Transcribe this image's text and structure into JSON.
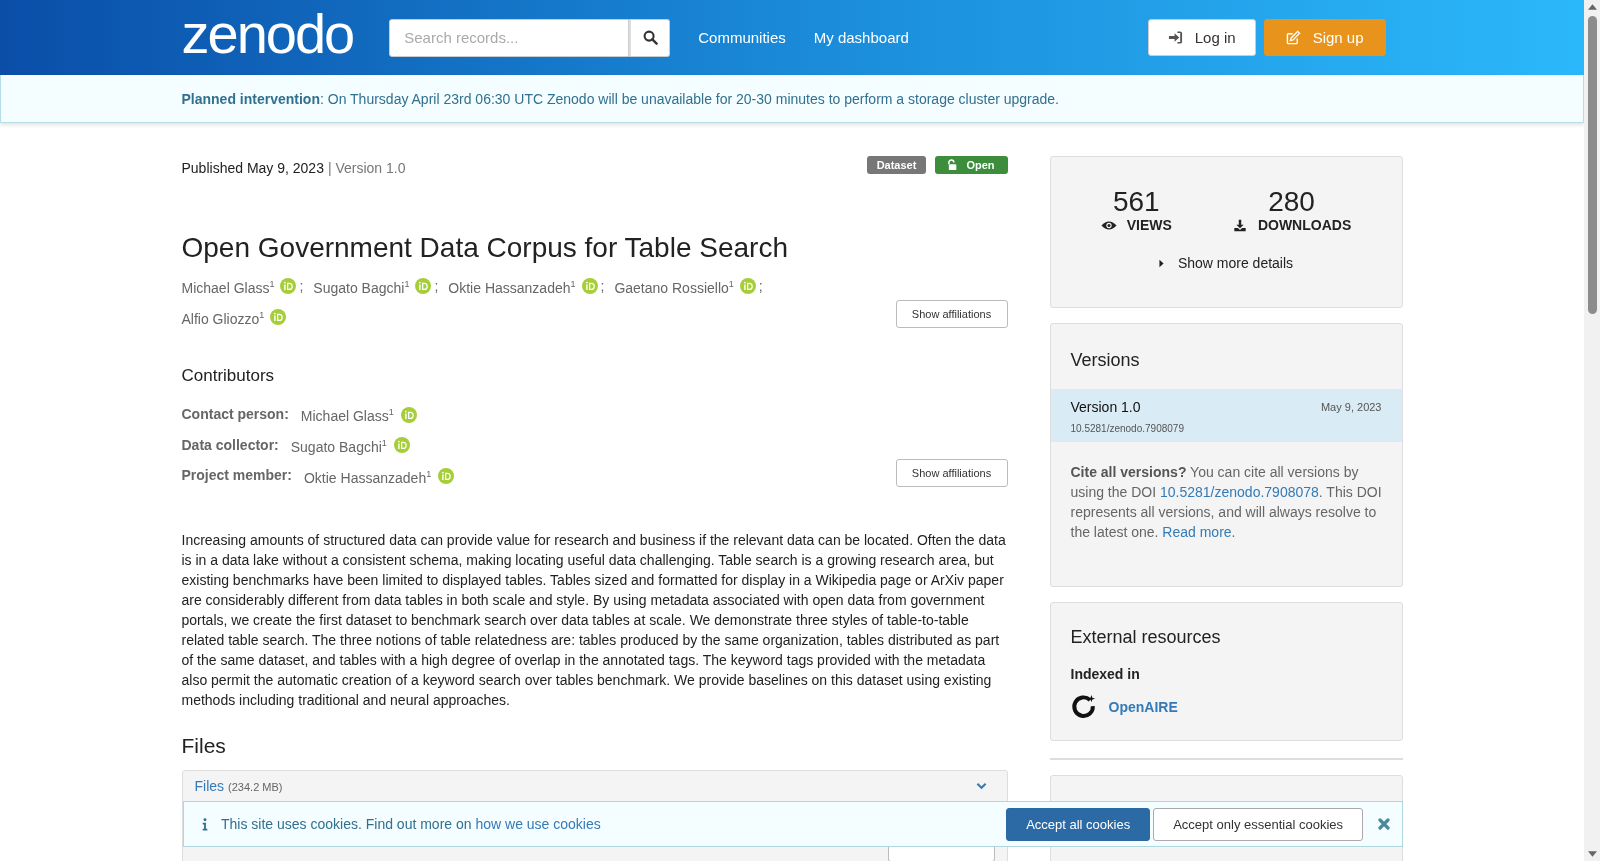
{
  "header": {
    "logo": "zenodo",
    "search": {
      "placeholder": "Search records..."
    },
    "nav": [
      "Communities",
      "My dashboard"
    ],
    "buttons": [
      {
        "label": "Log in",
        "kind": "login"
      },
      {
        "label": "Sign up",
        "kind": "signup"
      }
    ]
  },
  "notice": "**Planned intervention**: On Thursday April 23rd 06:30 UTC Zenodo will be unavailable for 20-30 minutes to perform a storage cluster upgrade.",
  "record": {
    "published": "Published May 9, 2023",
    "version": "| Version 1.0",
    "badges": [
      {
        "label": "Dataset",
        "kind": "type"
      },
      {
        "label": "Open",
        "kind": "access"
      }
    ],
    "title": "Open Government Data Corpus for Table Search",
    "authors": [
      {
        "name": "Michael Glass$^{1}$",
        "sep": ";"
      },
      {
        "name": "Sugato Bagchi$^{1}$",
        "sep": ";"
      },
      {
        "name": "Oktie Hassanzadeh$^{1}$",
        "sep": ";"
      },
      {
        "name": "Gaetano Rossiello$^{1}$",
        "sep": ";"
      },
      {
        "name": "Alfio Gliozzo$^{1}$"
      }
    ],
    "authors_button": "Show affiliations",
    "contributors_title": "Contributors",
    "contributors": [
      {
        "role": "Contact person:",
        "name": "Michael Glass$^{1}$"
      },
      {
        "role": "Data collector:",
        "name": "Sugato Bagchi$^{1}$"
      },
      {
        "role": "Project member:",
        "name": "Oktie Hassanzadeh$^{1}$"
      }
    ],
    "contributors_button": "Show affiliations",
    "abstract": "Increasing amounts of structured data can provide value for research and business if the relevant data can be located. Often the data is in a data lake without a consistent schema, making locating useful data challenging. Table search is a growing research area, but existing benchmarks have been limited to displayed tables. Tables sized and formatted for display in a Wikipedia page or ArXiv paper are considerably different from data tables in both scale and style. By using metadata associated with open data from government portals, we create the first dataset to benchmark search over data tables at scale. We demonstrate three styles of table-to-table related table search. The three notions of table relatedness are: tables produced by the same organization, tables distributed as part of the same dataset, and tables with a high degree of overlap in the annotated tags. The keyword tags provided with the metadata also permit the automatic creation of a keyword search over tables benchmark. We provide baselines on this dataset using existing methods including traditional and neural approaches.",
    "files_title": "Files",
    "files_panel": {
      "label": "Files",
      "size": "(234.2 MB)"
    }
  },
  "sidebar": {
    "stats": [
      {
        "value": "561",
        "label": "VIEWS",
        "kind": "views"
      },
      {
        "value": "280",
        "label": "DOWNLOADS",
        "kind": "downloads"
      }
    ],
    "more_details": "Show more details",
    "versions": {
      "title": "Versions",
      "items": [
        {
          "label": "Version 1.0",
          "date": "May 9, 2023",
          "doi": "10.5281/zenodo.7908079",
          "selected": true
        }
      ],
      "cite": [
        {
          "kind": "text",
          "text": "**Cite all versions?** You can cite all versions by using the DOI "
        },
        {
          "kind": "link",
          "text": "10.5281/zenodo.7908078"
        },
        {
          "kind": "text",
          "text": ". This DOI represents all versions, and will always resolve to the latest one. "
        },
        {
          "kind": "link",
          "text": "Read more"
        },
        {
          "kind": "text",
          "text": "."
        }
      ]
    },
    "external": {
      "title": "External resources",
      "subtitle": "Indexed in",
      "items": [
        "OpenAIRE"
      ]
    }
  },
  "cookie_banner": {
    "segments": [
      {
        "kind": "text",
        "text": "This site uses cookies. Find out more on "
      },
      {
        "kind": "link",
        "text": "how we use cookies"
      }
    ],
    "buttons": [
      {
        "label": "Accept all cookies",
        "kind": "primary"
      },
      {
        "label": "Accept only essential cookies",
        "kind": "secondary"
      }
    ]
  }
}
